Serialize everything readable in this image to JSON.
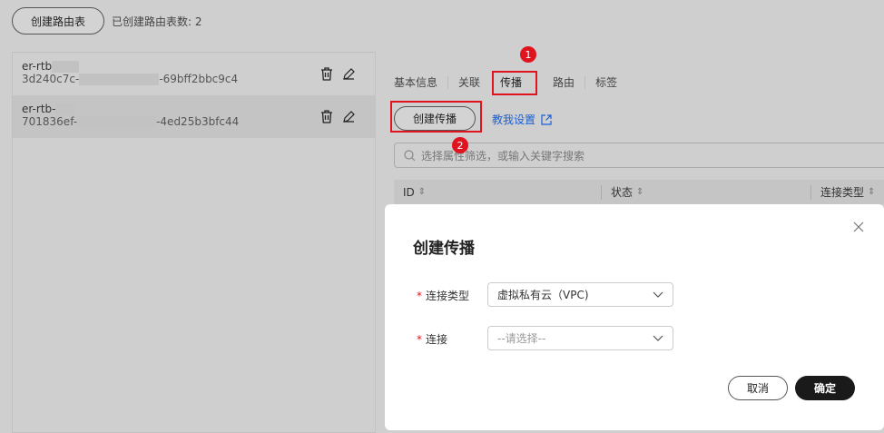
{
  "toolbar": {
    "create_label": "创建路由表",
    "count_text": "已创建路由表数: 2"
  },
  "route_tables": [
    {
      "name": "er-rtb",
      "id_prefix": "3d240c7c-",
      "id_suffix": "-69bff2bbc9c4"
    },
    {
      "name": "er-rtb-",
      "id_prefix": "701836ef-",
      "id_suffix": "-4ed25b3bfc44"
    }
  ],
  "tabs": [
    "基本信息",
    "关联",
    "传播",
    "路由",
    "标签"
  ],
  "active_tab": "传播",
  "actions": {
    "create_label": "创建传播",
    "help_link": "教我设置"
  },
  "badges": [
    "1",
    "2"
  ],
  "search": {
    "placeholder": "选择属性筛选，或输入关键字搜索"
  },
  "table": {
    "columns": [
      "ID",
      "状态",
      "连接类型"
    ]
  },
  "modal": {
    "title": "创建传播",
    "fields": [
      {
        "label": "连接类型",
        "value": "虚拟私有云（VPC)"
      },
      {
        "label": "连接",
        "placeholder": "--请选择--"
      }
    ],
    "cancel_label": "取消",
    "confirm_label": "确定"
  },
  "colors": {
    "accent_red": "#e0141e",
    "link": "#1a5fd6",
    "confirm_bg": "#1a1a1a"
  }
}
